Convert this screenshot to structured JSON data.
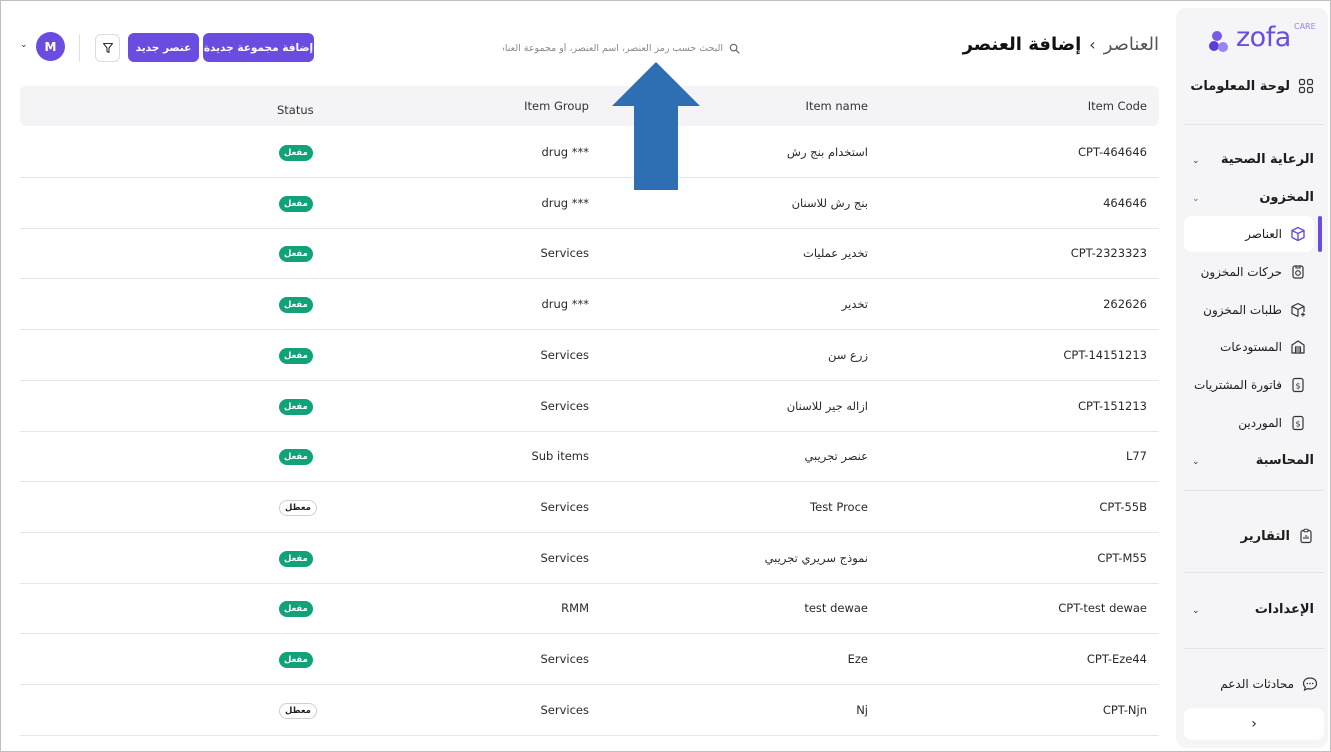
{
  "brand": {
    "name": "zofa",
    "tag": "CARE",
    "color": "#6a4ce0"
  },
  "sidebar": {
    "dashboard": "لوحة المعلومات",
    "healthcare": "الرعاية الصحية",
    "inventory": "المخزون",
    "inventory_items": [
      {
        "label": "العناصر",
        "icon": "box-icon",
        "active": true
      },
      {
        "label": "حركات المخزون",
        "icon": "inventory-moves-icon"
      },
      {
        "label": "طلبات المخزون",
        "icon": "inventory-requests-icon"
      },
      {
        "label": "المستودعات",
        "icon": "warehouse-icon"
      },
      {
        "label": "فاتورة المشتريات",
        "icon": "invoice-icon"
      },
      {
        "label": "الموردين",
        "icon": "suppliers-icon"
      }
    ],
    "accounting": "المحاسبة",
    "reports": "التقارير",
    "settings": "الإعدادات",
    "support": "محادثات الدعم",
    "collapse": "›"
  },
  "header": {
    "breadcrumb_parent": "العناصر",
    "breadcrumb_sep": "›",
    "breadcrumb_current": "إضافة العنصر",
    "search_placeholder": "البحث حسب رمز العنصر، اسم العنصر، أو مجموعة العناصر",
    "add_group_button": "إضافة مجموعة جديدة",
    "new_item_button": "عنصر جديد",
    "avatar_initial": "M"
  },
  "table": {
    "columns": {
      "code": "Item Code",
      "name": "Item name",
      "group": "Item Group",
      "status": "Status"
    },
    "rows": [
      {
        "code": "CPT-464646",
        "name": "استخدام بنج رش",
        "group": "drug ***",
        "status": "مفعل",
        "active": true
      },
      {
        "code": "464646",
        "name": "بنج رش للاسنان",
        "group": "drug ***",
        "status": "مفعل",
        "active": true
      },
      {
        "code": "CPT-2323323",
        "name": "تخدير عمليات",
        "group": "Services",
        "status": "مفعل",
        "active": true
      },
      {
        "code": "262626",
        "name": "تخدير",
        "group": "drug ***",
        "status": "مفعل",
        "active": true
      },
      {
        "code": "CPT-14151213",
        "name": "زرع سن",
        "group": "Services",
        "status": "مفعل",
        "active": true
      },
      {
        "code": "CPT-151213",
        "name": "ازاله جير للاسنان",
        "group": "Services",
        "status": "مفعل",
        "active": true
      },
      {
        "code": "L77",
        "name": "عنصر تجريبي",
        "group": "Sub items",
        "status": "مفعل",
        "active": true
      },
      {
        "code": "CPT-55B",
        "name": "Test Proce",
        "group": "Services",
        "status": "معطل",
        "active": false
      },
      {
        "code": "CPT-M55",
        "name": "نموذج سريري تجريبي",
        "group": "Services",
        "status": "مفعل",
        "active": true
      },
      {
        "code": "CPT-test dewae",
        "name": "test dewae",
        "group": "RMM",
        "status": "مفعل",
        "active": true
      },
      {
        "code": "CPT-Eze44",
        "name": "Eze",
        "group": "Services",
        "status": "مفعل",
        "active": true
      },
      {
        "code": "CPT-Njn",
        "name": "Nj",
        "group": "Services",
        "status": "معطل",
        "active": false
      }
    ]
  },
  "colors": {
    "accent": "#6a4ce0",
    "active_badge": "#11a27a",
    "arrow": "#2e6fb4"
  }
}
